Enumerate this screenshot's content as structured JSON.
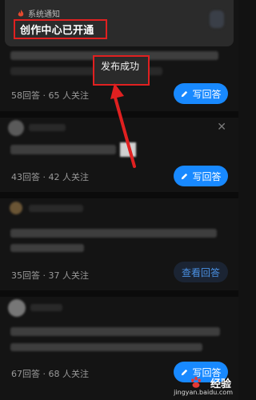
{
  "notification": {
    "app_label": "系统通知",
    "title": "创作中心已开通"
  },
  "toast": {
    "text": "发布成功"
  },
  "questions": [
    {
      "stats": "58回答 · 65 人关注",
      "action_label": "写回答"
    },
    {
      "stats": "43回答 · 42 人关注",
      "action_label": "写回答"
    },
    {
      "stats": "35回答 · 37 人关注",
      "action_label": "查看回答"
    },
    {
      "stats": "67回答 · 68 人关注",
      "action_label": "写回答"
    }
  ],
  "close_icon": "close-icon",
  "colors": {
    "primary_button": "#1889ff",
    "highlight_box": "#e02020",
    "arrow": "#e02020"
  },
  "watermark": {
    "brand": "经验",
    "url": "jingyan.baidu.com"
  }
}
